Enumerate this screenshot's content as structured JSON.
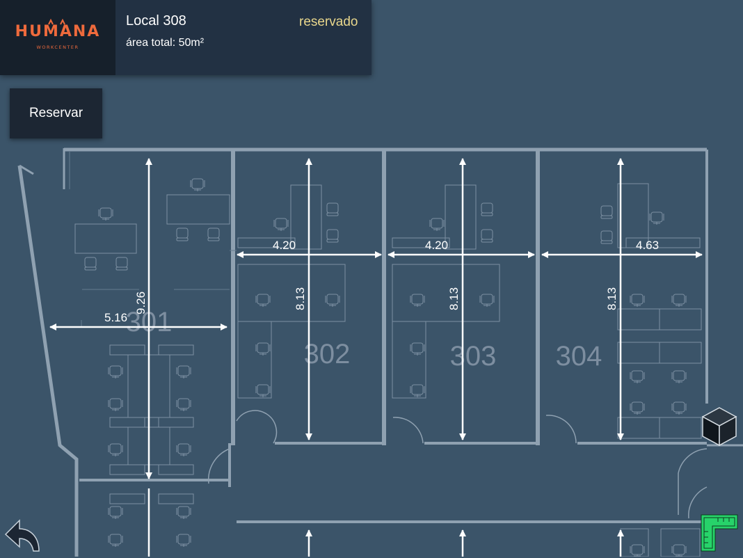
{
  "header": {
    "logo": {
      "name": "HUMANA",
      "tagline": "WORKCENTER"
    },
    "local_title": "Local 308",
    "status": "reservado",
    "area": "área total: 50m²"
  },
  "actions": {
    "reserve_label": "Reservar"
  },
  "rooms": [
    {
      "number": "301",
      "width": "5.16",
      "depth": "9.26"
    },
    {
      "number": "302",
      "width": "4.20",
      "depth": "8.13"
    },
    {
      "number": "303",
      "width": "4.20",
      "depth": "8.13"
    },
    {
      "number": "304",
      "width": "4.63",
      "depth": "8.13"
    }
  ],
  "icons": {
    "back": "back-arrow-icon",
    "view_3d": "cube-icon",
    "measure": "ruler-icon"
  },
  "colors": {
    "background": "#3b5469",
    "header": "#223143",
    "brand": "#ee6a3c",
    "status": "#e9d78c",
    "measure_icon": "#27d36a"
  }
}
